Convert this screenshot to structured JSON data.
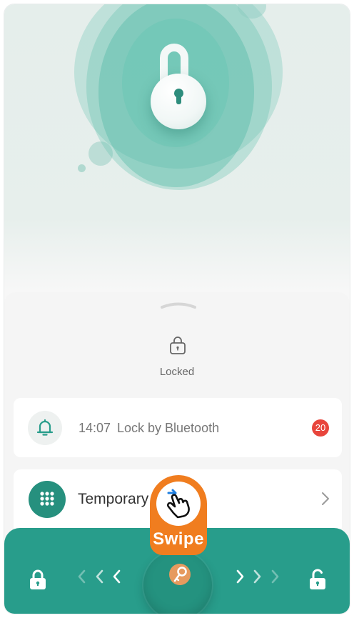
{
  "status": {
    "label": "Locked"
  },
  "log": {
    "time": "14:07",
    "text": "Lock by Bluetooth",
    "badge": "20"
  },
  "temporary": {
    "label": "Temporary"
  },
  "hint": {
    "label": "Swipe"
  },
  "colors": {
    "accent": "#289d8b",
    "hint": "#f07d1f",
    "badge": "#e8453c"
  },
  "icons": [
    "padlock-icon",
    "bell-icon",
    "keypad-icon",
    "chevron-right-icon",
    "key-icon",
    "hand-swipe-icon",
    "unlock-icon"
  ]
}
